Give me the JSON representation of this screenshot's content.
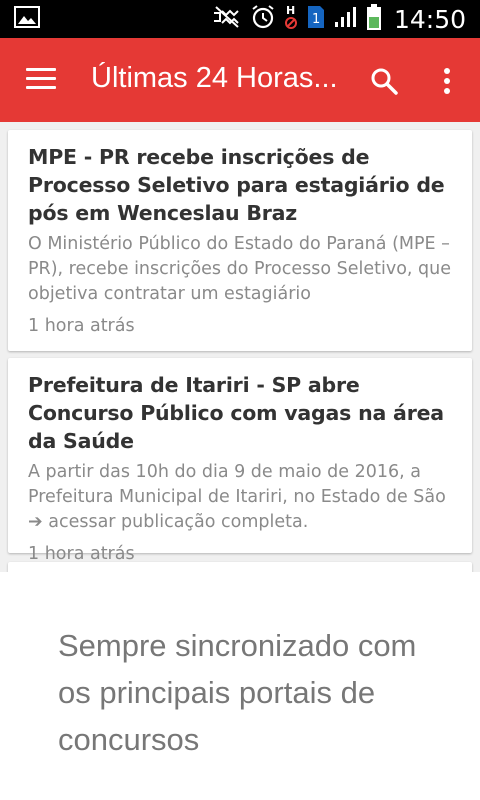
{
  "status_bar": {
    "time": "14:50",
    "icons": [
      "image-icon",
      "mute-icon",
      "alarm-icon",
      "hd-icon",
      "sim1-icon",
      "signal-icon",
      "battery-icon"
    ],
    "sim_label": "1",
    "hd_label": "H"
  },
  "app_bar": {
    "title": "Últimas 24 Horas...",
    "color": "#e53935",
    "icons": [
      "menu-icon",
      "search-icon",
      "more-vert-icon"
    ]
  },
  "articles": [
    {
      "title": "MPE - PR recebe inscrições de Processo Seletivo para estagiário de pós em Wenceslau Braz",
      "excerpt": "O Ministério Público do Estado do Paraná (MPE – PR), recebe inscrições do Processo Seletivo, que objetiva contratar um estagiário",
      "time": "1 hora atrás"
    },
    {
      "title": "Prefeitura de Itariri - SP abre Concurso Público com vagas na área da Saúde",
      "excerpt": "A partir das 10h do dia 9 de maio de 2016, a Prefeitura Municipal de Itariri, no Estado de São ➔ acessar publicação completa.",
      "time": "1 hora atrás"
    }
  ],
  "overlay": {
    "message": "Sempre sincronizado com os principais portais de concursos"
  }
}
